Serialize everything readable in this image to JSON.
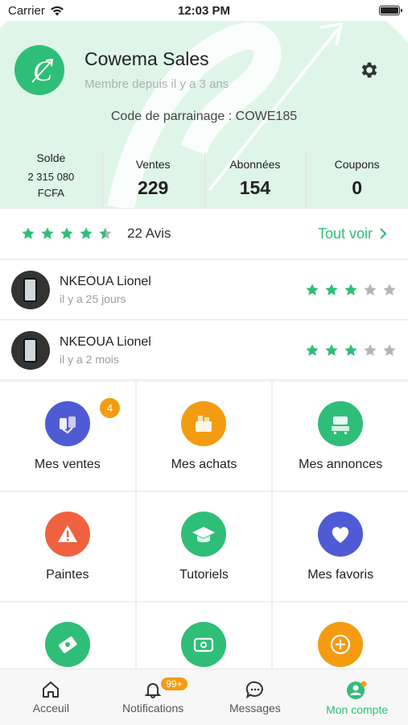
{
  "status_bar": {
    "carrier": "Carrier",
    "time": "12:03 PM"
  },
  "profile": {
    "name": "Cowema Sales",
    "member_since": "Membre depuis il y a 3 ans",
    "referral": "Code de parrainage : COWE185",
    "logo_letter": "C"
  },
  "stats": {
    "solde_label": "Solde",
    "solde_amount": "2 315 080",
    "solde_currency": "FCFA",
    "ventes_label": "Ventes",
    "ventes_value": "229",
    "abonnees_label": "Abonnées",
    "abonnees_value": "154",
    "coupons_label": "Coupons",
    "coupons_value": "0"
  },
  "rating": {
    "value": 4.5,
    "count_label": "22 Avis",
    "see_all": "Tout voir"
  },
  "reviews": [
    {
      "name": "NKEOUA Lionel",
      "time": "il y a 25 jours",
      "stars": 3
    },
    {
      "name": "NKEOUA Lionel",
      "time": "il y a 2 mois",
      "stars": 3
    }
  ],
  "menu": [
    {
      "label": "Mes ventes",
      "icon": "sales-icon",
      "color": "#4f5bd5",
      "badge": "4"
    },
    {
      "label": "Mes achats",
      "icon": "purchases-icon",
      "color": "#f39c12"
    },
    {
      "label": "Mes annonces",
      "icon": "listings-icon",
      "color": "#2fbe78"
    },
    {
      "label": "Paintes",
      "icon": "complaint-icon",
      "color": "#f0623f"
    },
    {
      "label": "Tutoriels",
      "icon": "graduation-cap-icon",
      "color": "#2fbe78"
    },
    {
      "label": "Mes favoris",
      "icon": "heart-icon",
      "color": "#4f5bd5"
    },
    {
      "label": "",
      "icon": "money-icon",
      "color": "#2fbe78"
    },
    {
      "label": "",
      "icon": "wallet-icon",
      "color": "#2fbe78"
    },
    {
      "label": "",
      "icon": "plus-circle-icon",
      "color": "#f39c12"
    }
  ],
  "tabs": {
    "home": "Acceuil",
    "notifications": "Notifications",
    "notifications_badge": "99+",
    "messages": "Messages",
    "account": "Mon compte"
  },
  "colors": {
    "accent": "#2fbe78",
    "badge": "#f39c12"
  }
}
